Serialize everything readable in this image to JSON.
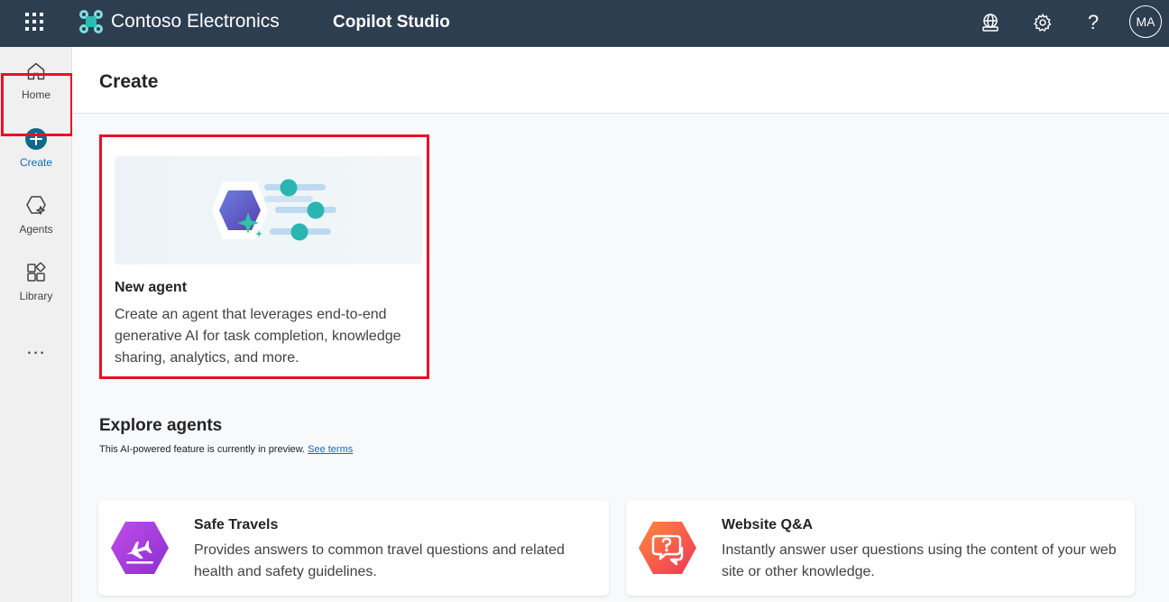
{
  "header": {
    "brand_name": "Contoso Electronics",
    "product_name": "Copilot Studio",
    "avatar_initials": "MA",
    "help_glyph": "?",
    "icons": [
      "app-launcher-icon",
      "environment-globe-icon",
      "settings-gear-icon",
      "help-icon"
    ]
  },
  "sidebar": {
    "items": [
      {
        "label": "Home",
        "icon": "home-icon"
      },
      {
        "label": "Create",
        "icon": "plus-circle-icon",
        "active": true
      },
      {
        "label": "Agents",
        "icon": "agents-icon"
      },
      {
        "label": "Library",
        "icon": "library-icon"
      }
    ],
    "more": "..."
  },
  "main": {
    "title": "Create",
    "new_agent": {
      "title": "New agent",
      "description": "Create an agent that leverages end-to-end generative AI for task completion, knowledge sharing, analytics, and more."
    },
    "explore": {
      "title": "Explore agents",
      "subtitle": "This AI-powered feature is currently in preview.",
      "link": "See terms"
    },
    "agents": [
      {
        "title": "Safe Travels",
        "description": "Provides answers to common travel questions and related health and safety guidelines.",
        "icon": "airplane-icon"
      },
      {
        "title": "Website Q&A",
        "description": "Instantly answer user questions using the content of your web site or other knowledge.",
        "icon": "question-chat-icon"
      }
    ]
  },
  "colors": {
    "topbar": "#2d3e50",
    "highlight": "#e81123",
    "accent": "#0f6cbd"
  }
}
